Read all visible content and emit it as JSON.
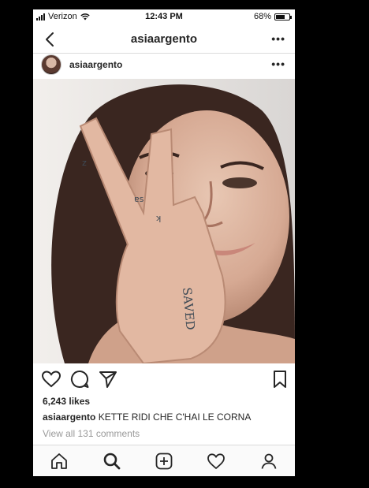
{
  "status_bar": {
    "carrier": "Verizon",
    "time": "12:43 PM",
    "battery_percent": "68%",
    "battery_level": 0.68
  },
  "nav": {
    "title": "asiaargento",
    "more": "•••"
  },
  "post": {
    "username": "asiaargento",
    "more": "•••",
    "likes": "6,243 likes",
    "caption_user": "asiaargento",
    "caption_text": "KETTE RIDI CHE C'HAI LE CORNA",
    "comments_link": "View all 131 comments"
  },
  "icons": {
    "back": "chevron-left-icon",
    "like": "heart-icon",
    "comment": "comment-bubble-icon",
    "share": "paper-plane-icon",
    "save": "bookmark-icon",
    "tabs": [
      "home-icon",
      "search-icon",
      "add-post-icon",
      "activity-heart-icon",
      "profile-icon"
    ]
  },
  "colors": {
    "text": "#262626",
    "muted": "#999999",
    "divider": "#dbdbdb",
    "frame": "#000000"
  }
}
